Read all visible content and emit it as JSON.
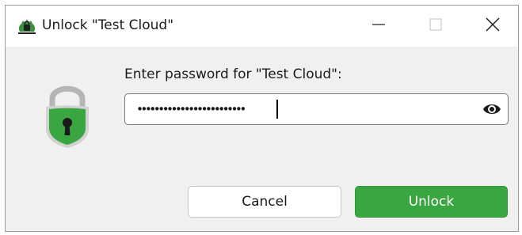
{
  "window": {
    "title": "Unlock \"Test Cloud\"",
    "app_icon": "cryptomator-app-icon",
    "controls": [
      "minimize-icon",
      "maximize-icon",
      "close-icon"
    ]
  },
  "dialog": {
    "lock_icon": "lock-icon",
    "prompt": "Enter password for \"Test Cloud\":",
    "password": {
      "masked_value": "•••••••••••••••••••••••••",
      "toggle_icon": "eye-icon"
    },
    "buttons": {
      "cancel_label": "Cancel",
      "unlock_label": "Unlock"
    }
  },
  "colors": {
    "accent": "#3aa641",
    "lock_body": "#3aa641",
    "lock_shackle": "#b5b5b5",
    "window_bg": "#f0f0f0"
  }
}
